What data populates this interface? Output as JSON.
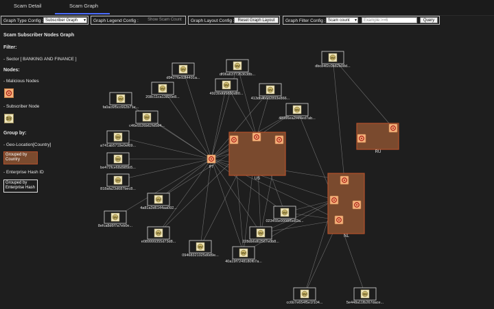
{
  "tabs": [
    {
      "label": "Scam Detail",
      "active": false
    },
    {
      "label": "Scam Graph",
      "active": true
    }
  ],
  "toolbar": {
    "graph_type": {
      "label": "Graph Type Config :",
      "value": "Subscriber Graph"
    },
    "legend": {
      "label": "Graph Legend Config :",
      "button": "Show Scam Count"
    },
    "layout": {
      "label": "Graph Layout Config :",
      "button": "Reset Graph Layout"
    },
    "filter": {
      "label": "Graph Filter Config :",
      "value": "Scam count",
      "placeholder": "Example:>=6",
      "query_button": "Query"
    }
  },
  "sidebar": {
    "title": "Scam Subscriber Nodes Graph",
    "filter_label": "Filter:",
    "filter_value": "- Sector [ BANKING AND FINANCE ]",
    "nodes_label": "Nodes:",
    "malicious_label": "- Malicious Nodes",
    "subscriber_label": "- Subscriber Node",
    "group_by_label": "Group by:",
    "geo_label": "- Geo-Location[Country]",
    "grouped_country": "Grouped by Country",
    "enterprise_label": "- Enterprise Hash ID",
    "grouped_enterprise": "Grouped by Enterprise Hash"
  },
  "colors": {
    "group_fill": "#7a4a2e",
    "group_border": "#b3502c",
    "malicious_fill": "#f3b07a",
    "subscriber_fill": "#efe6bd",
    "edge": "#8a8a8a",
    "tab_accent": "#4a6cff"
  },
  "graph": {
    "groups": [
      {
        "id": "US",
        "label": "US"
      },
      {
        "id": "RU",
        "label": "RU"
      },
      {
        "id": "NL",
        "label": "NL"
      }
    ],
    "malicious_nodes": [
      {
        "id": "m-pt",
        "label": "PT",
        "group": null
      },
      {
        "id": "m-us1",
        "label": "",
        "group": "US"
      },
      {
        "id": "m-us2",
        "label": "",
        "group": "US"
      },
      {
        "id": "m-us3",
        "label": "",
        "group": "US"
      },
      {
        "id": "m-ru1",
        "label": "",
        "group": "RU"
      },
      {
        "id": "m-ru2",
        "label": "",
        "group": "RU"
      },
      {
        "id": "m-nl1",
        "label": "",
        "group": "NL"
      },
      {
        "id": "m-nl2",
        "label": "",
        "group": "NL"
      },
      {
        "id": "m-nl3",
        "label": "",
        "group": "NL"
      },
      {
        "id": "m-nl4",
        "label": "",
        "group": "NL"
      }
    ],
    "subscriber_nodes": [
      {
        "id": "s1",
        "label": "d94276e93f4491a..."
      },
      {
        "id": "s2",
        "label": "df06a6377263638b..."
      },
      {
        "id": "s3",
        "label": "dbc84f2c0b82b08d..."
      },
      {
        "id": "s4",
        "label": "208c11ca13820e8..."
      },
      {
        "id": "s5",
        "label": "49230d6f9890d80..."
      },
      {
        "id": "s6",
        "label": "413db4b6d2893e866..."
      },
      {
        "id": "s7",
        "label": "fa0ac6f5cc662b71e..."
      },
      {
        "id": "s8",
        "label": "c46e5526b62fd5d4..."
      },
      {
        "id": "s9",
        "label": "48996ea2f4f4ed7ab..."
      },
      {
        "id": "s10",
        "label": "a741ab5719e0ef69..."
      },
      {
        "id": "s11",
        "label": "be472fce68d985b5..."
      },
      {
        "id": "s12",
        "label": "818afa23d687bec8..."
      },
      {
        "id": "s13",
        "label": "4a81a3d6144aa092..."
      },
      {
        "id": "s14",
        "label": "8efca8d6f7a7eb0e..."
      },
      {
        "id": "s15",
        "label": "023455e9998f5e82a..."
      },
      {
        "id": "s16",
        "label": "e089999355d73d8..."
      },
      {
        "id": "s17",
        "label": "228db6d62567e0b8..."
      },
      {
        "id": "s18",
        "label": "09468321025d0d9e..."
      },
      {
        "id": "s19",
        "label": "40a19f7248180f67a..."
      },
      {
        "id": "s20",
        "label": "cc6b7e654f5e1f104..."
      },
      {
        "id": "s21",
        "label": "5e448a11fb267dace..."
      }
    ]
  }
}
